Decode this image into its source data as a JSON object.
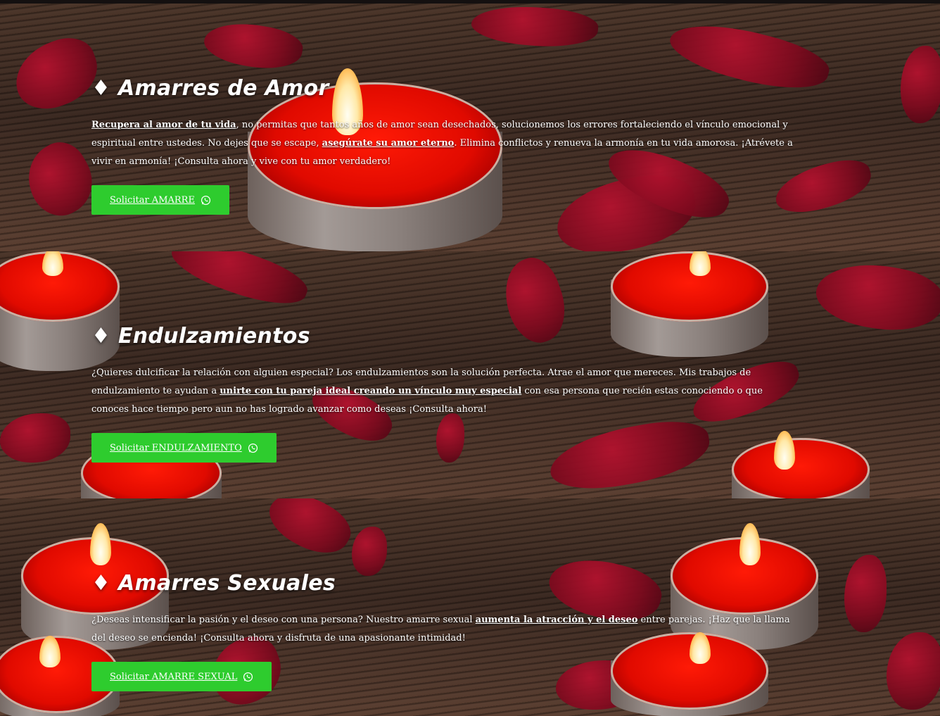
{
  "sections": [
    {
      "heading": "♦ Amarres de Amor",
      "para": {
        "link1": "Recupera al amor de tu vida",
        "text1": ", no permitas que tantos años de amor sean desechados, solucionemos los errores fortaleciendo el vínculo emocional y espiritual entre ustedes. No dejes que se escape, ",
        "link2": "asegúrate su amor eterno",
        "text2": ". Elimina conflictos y renueva la armonía en tu vida amorosa. ¡Atrévete a vivir en armonía! ¡Consulta ahora y vive con tu amor verdadero!"
      },
      "button": "Solicitar AMARRE"
    },
    {
      "heading": "♦ Endulzamientos",
      "para": {
        "text1": "¿Quieres dulcificar la relación con alguien especial? Los endulzamientos son la solución perfecta. Atrae el amor que mereces. Mis trabajos de endulzamiento te ayudan a ",
        "link1": "unirte con tu pareja ideal creando un vínculo muy especial",
        "text2": " con esa persona que recién estas conociendo o que conoces hace tiempo pero aun no has logrado avanzar como deseas ¡Consulta ahora!"
      },
      "button": "Solicitar ENDULZAMIENTO"
    },
    {
      "heading": "♦ Amarres Sexuales",
      "para": {
        "text1": "¿Deseas intensificar la pasión y el deseo con una persona? Nuestro amarre sexual ",
        "link1": "aumenta la atracción y el deseo",
        "text2": " entre parejas. ¡Haz que la llama del deseo se encienda! ¡Consulta ahora y disfruta de una apasionante intimidad!"
      },
      "button": "Solicitar AMARRE SEXUAL"
    }
  ],
  "icons": {
    "button_icon": "whatsapp-icon"
  },
  "colors": {
    "button_bg": "#2ecc2e",
    "text": "#ffffff"
  }
}
